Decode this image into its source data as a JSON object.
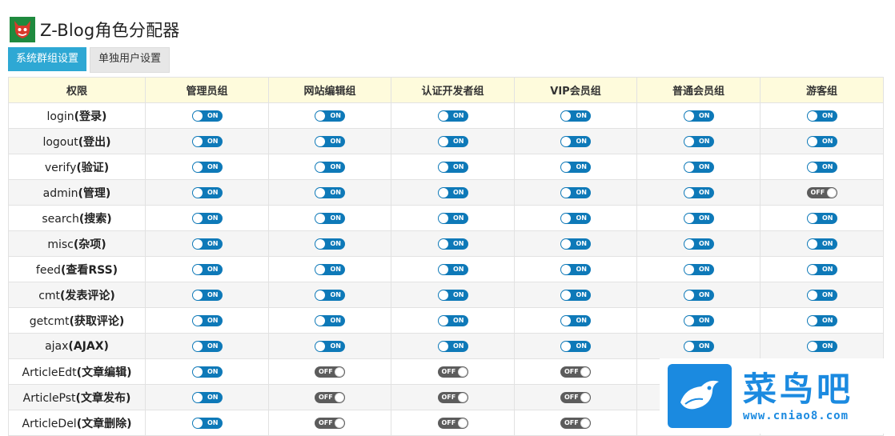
{
  "app": {
    "title": "Z-Blog角色分配器",
    "logo_icon": "devil-logo-icon"
  },
  "tabs": [
    {
      "label": "系统群组设置",
      "active": true
    },
    {
      "label": "单独用户设置",
      "active": false
    }
  ],
  "table": {
    "headers": [
      "权限",
      "管理员组",
      "网站编辑组",
      "认证开发者组",
      "VIP会员组",
      "普通会员组",
      "游客组"
    ],
    "toggle_on_label": "ON",
    "toggle_off_label": "OFF",
    "rows": [
      {
        "name": "login",
        "desc": "(登录)",
        "states": [
          true,
          true,
          true,
          true,
          true,
          true
        ]
      },
      {
        "name": "logout",
        "desc": "(登出)",
        "states": [
          true,
          true,
          true,
          true,
          true,
          true
        ]
      },
      {
        "name": "verify",
        "desc": "(验证)",
        "states": [
          true,
          true,
          true,
          true,
          true,
          true
        ]
      },
      {
        "name": "admin",
        "desc": "(管理)",
        "states": [
          true,
          true,
          true,
          true,
          true,
          false
        ]
      },
      {
        "name": "search",
        "desc": "(搜索)",
        "states": [
          true,
          true,
          true,
          true,
          true,
          true
        ]
      },
      {
        "name": "misc",
        "desc": "(杂项)",
        "states": [
          true,
          true,
          true,
          true,
          true,
          true
        ]
      },
      {
        "name": "feed",
        "desc": "(查看RSS)",
        "states": [
          true,
          true,
          true,
          true,
          true,
          true
        ]
      },
      {
        "name": "cmt",
        "desc": "(发表评论)",
        "states": [
          true,
          true,
          true,
          true,
          true,
          true
        ]
      },
      {
        "name": "getcmt",
        "desc": "(获取评论)",
        "states": [
          true,
          true,
          true,
          true,
          true,
          true
        ]
      },
      {
        "name": "ajax",
        "desc": "(AJAX)",
        "states": [
          true,
          true,
          true,
          true,
          true,
          true
        ]
      },
      {
        "name": "ArticleEdt",
        "desc": "(文章编辑)",
        "states": [
          true,
          false,
          false,
          false,
          null,
          null
        ]
      },
      {
        "name": "ArticlePst",
        "desc": "(文章发布)",
        "states": [
          true,
          false,
          false,
          false,
          null,
          null
        ]
      },
      {
        "name": "ArticleDel",
        "desc": "(文章删除)",
        "states": [
          true,
          false,
          false,
          false,
          null,
          null
        ]
      }
    ]
  },
  "watermark": {
    "brand": "菜鸟吧",
    "url": "www.cniao8.com",
    "color": "#1b8ae0"
  }
}
